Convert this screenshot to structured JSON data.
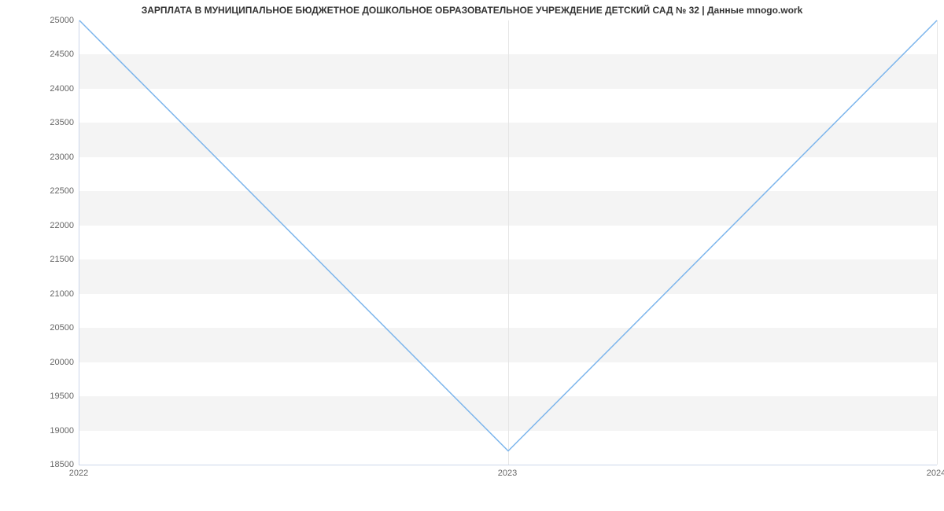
{
  "chart_data": {
    "type": "line",
    "title": "ЗАРПЛАТА В МУНИЦИПАЛЬНОЕ БЮДЖЕТНОЕ ДОШКОЛЬНОЕ ОБРАЗОВАТЕЛЬНОЕ УЧРЕЖДЕНИЕ ДЕТСКИЙ САД № 32 | Данные mnogo.work",
    "x": [
      2022,
      2023,
      2024
    ],
    "values": [
      25000,
      18700,
      25000
    ],
    "xlabel": "",
    "ylabel": "",
    "xlim": [
      2022,
      2024
    ],
    "ylim": [
      18500,
      25000
    ],
    "x_ticks": [
      2022,
      2023,
      2024
    ],
    "y_ticks": [
      18500,
      19000,
      19500,
      20000,
      20500,
      21000,
      21500,
      22000,
      22500,
      23000,
      23500,
      24000,
      24500,
      25000
    ],
    "line_color": "#7cb5ec",
    "band_color": "#f4f4f4"
  }
}
